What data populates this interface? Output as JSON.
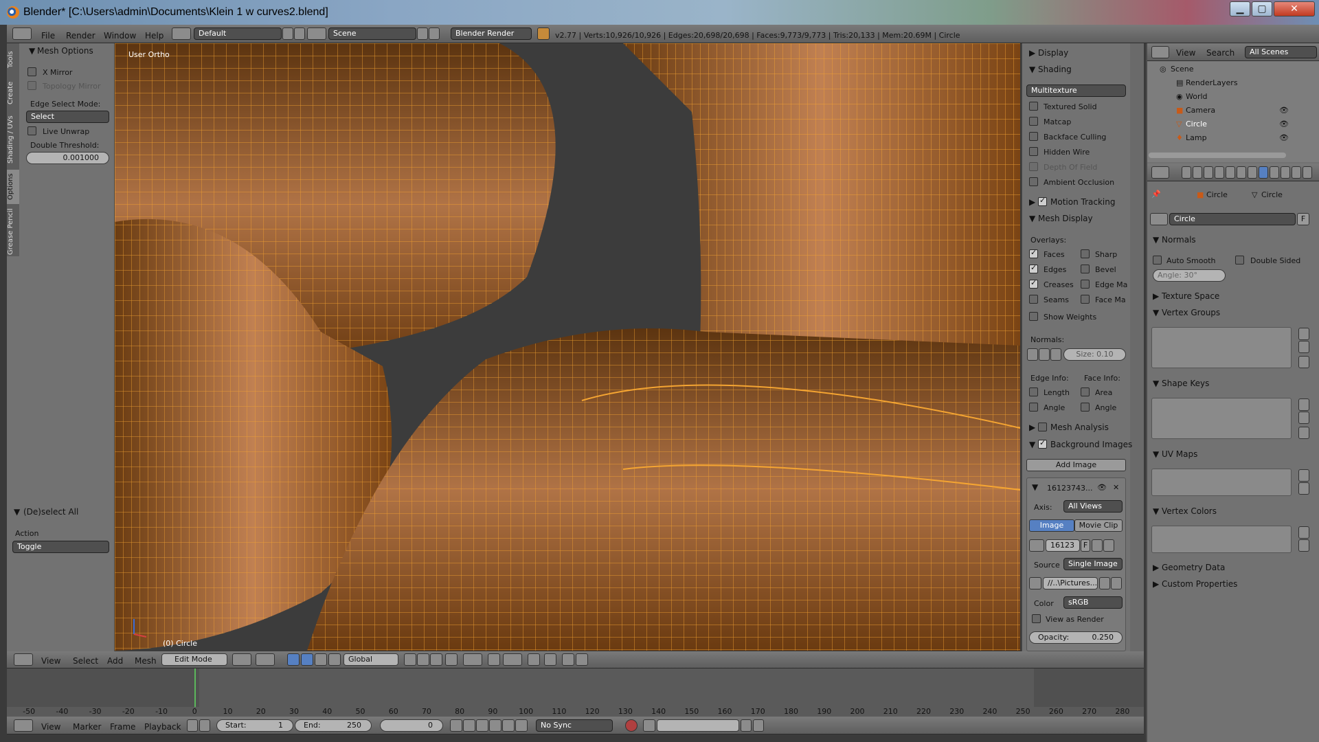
{
  "window": {
    "title": "Blender* [C:\\Users\\admin\\Documents\\Klein 1 w curves2.blend]",
    "minimize": "▁",
    "maximize": "▢",
    "close": "✕"
  },
  "topbar": {
    "menus": [
      "File",
      "Render",
      "Window",
      "Help"
    ],
    "layout": "Default",
    "scene": "Scene",
    "engine": "Blender Render",
    "stats": "v2.77 | Verts:10,926/10,926 | Edges:20,698/20,698 | Faces:9,773/9,773 | Tris:20,133 | Mem:20.69M | Circle"
  },
  "toolshelf": {
    "tabs": [
      "Tools",
      "Create",
      "Shading / UVs",
      "Options",
      "Grease Pencil"
    ],
    "panel_title": "Mesh Options",
    "x_mirror": "X Mirror",
    "topology_mirror": "Topology Mirror",
    "edge_select_label": "Edge Select Mode:",
    "edge_select_value": "Select",
    "live_unwrap": "Live Unwrap",
    "double_threshold_label": "Double Threshold:",
    "double_threshold_value": "0.001000",
    "operator_title": "(De)select All",
    "action_label": "Action",
    "action_value": "Toggle"
  },
  "viewport": {
    "view_label": "User Ortho",
    "object_label": "(0) Circle",
    "mesh_color": "#e8931e"
  },
  "npanel": {
    "display": "Display",
    "shading": "Shading",
    "shading_mode": "Multitexture",
    "shading_opts": [
      "Textured Solid",
      "Matcap",
      "Backface Culling",
      "Hidden Wire",
      "Depth Of Field",
      "Ambient Occlusion"
    ],
    "motion_tracking": "Motion Tracking",
    "mesh_display": "Mesh Display",
    "overlays": "Overlays:",
    "overlays_left": [
      "Faces",
      "Edges",
      "Creases",
      "Seams"
    ],
    "overlays_right": [
      "Sharp",
      "Bevel",
      "Edge Ma",
      "Face Ma"
    ],
    "show_weights": "Show Weights",
    "normals": "Normals:",
    "normals_size": "Size:  0.10",
    "edge_info": "Edge Info:",
    "face_info": "Face Info:",
    "edge_length": "Length",
    "edge_angle": "Angle",
    "face_area": "Area",
    "face_angle": "Angle",
    "mesh_analysis": "Mesh Analysis",
    "background_images": "Background Images",
    "add_image": "Add Image",
    "bg_name": "16123743...",
    "axis_label": "Axis:",
    "axis_value": "All Views",
    "tab_image": "Image",
    "tab_movieclip": "Movie Clip",
    "img_field": "16123",
    "img_f": "F",
    "source_label": "Source",
    "source_value": "Single Image",
    "path_value": "//..\\Pictures...",
    "color_label": "Color",
    "color_value": "sRGB",
    "view_as_render": "View as Render",
    "opacity": "Opacity:",
    "opacity_value": "0.250"
  },
  "outliner": {
    "view": "View",
    "search": "Search",
    "filter": "All Scenes",
    "items": [
      "Scene",
      "RenderLayers",
      "World",
      "Camera",
      "Circle",
      "Lamp"
    ]
  },
  "properties": {
    "breadcrumb_obj": "Circle",
    "breadcrumb_mesh": "Circle",
    "mesh_name": "Circle",
    "fake_user": "F",
    "normals": "Normals",
    "auto_smooth": "Auto Smooth",
    "double_sided": "Double Sided",
    "angle": "Angle:      30°",
    "texture_space": "Texture Space",
    "vertex_groups": "Vertex Groups",
    "shape_keys": "Shape Keys",
    "uv_maps": "UV Maps",
    "vertex_colors": "Vertex Colors",
    "geometry_data": "Geometry Data",
    "custom_properties": "Custom Properties"
  },
  "view3d_header": {
    "menus": [
      "View",
      "Select",
      "Add",
      "Mesh"
    ],
    "mode": "Edit Mode",
    "orientation": "Global"
  },
  "timeline": {
    "ticks": [
      "-50",
      "-40",
      "-30",
      "-20",
      "-10",
      "0",
      "10",
      "20",
      "30",
      "40",
      "50",
      "60",
      "70",
      "80",
      "90",
      "100",
      "110",
      "120",
      "130",
      "140",
      "150",
      "160",
      "170",
      "180",
      "190",
      "200",
      "210",
      "220",
      "230",
      "240",
      "250",
      "260",
      "270",
      "280"
    ],
    "current_frame": 0
  },
  "playback": {
    "menus": [
      "View",
      "Marker",
      "Frame",
      "Playback"
    ],
    "start": "Start:",
    "start_value": "1",
    "end": "End:",
    "end_value": "250",
    "frame": "0",
    "sync": "No Sync"
  }
}
